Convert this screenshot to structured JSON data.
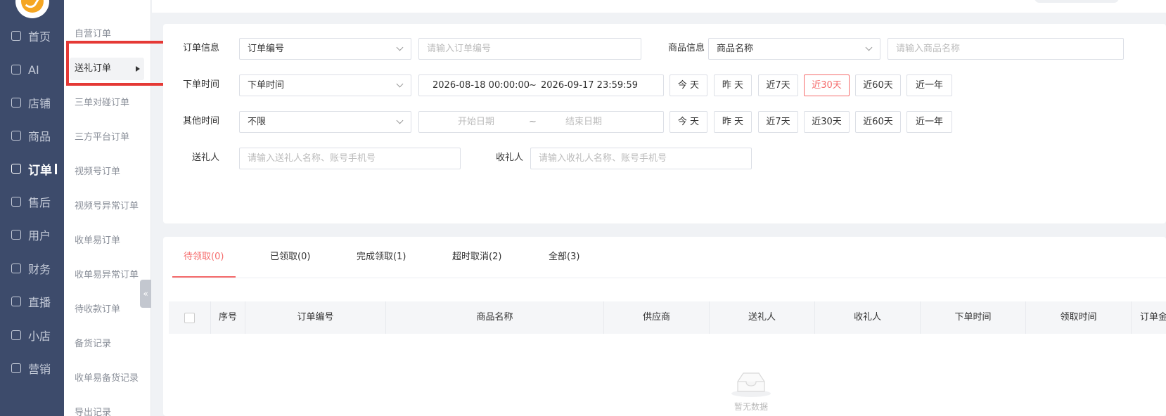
{
  "nav": {
    "items": [
      {
        "label": "首页",
        "icon": "home-icon"
      },
      {
        "label": "AI",
        "icon": "robot-icon"
      },
      {
        "label": "店铺",
        "icon": "shop-icon"
      },
      {
        "label": "商品",
        "icon": "goods-icon"
      },
      {
        "label": "订单",
        "icon": "order-icon",
        "active": true
      },
      {
        "label": "售后",
        "icon": "after-sales-icon"
      },
      {
        "label": "用户",
        "icon": "user-icon"
      },
      {
        "label": "财务",
        "icon": "finance-icon"
      },
      {
        "label": "直播",
        "icon": "live-icon"
      },
      {
        "label": "小店",
        "icon": "store-icon"
      },
      {
        "label": "营销",
        "icon": "marketing-icon"
      }
    ]
  },
  "submenu": {
    "items": [
      {
        "label": "自营订单"
      },
      {
        "label": "送礼订单",
        "active": true
      },
      {
        "label": "三单对碰订单"
      },
      {
        "label": "三方平台订单"
      },
      {
        "label": "视频号订单"
      },
      {
        "label": "视频号异常订单"
      },
      {
        "label": "收单易订单"
      },
      {
        "label": "收单易异常订单"
      },
      {
        "label": "待收款订单"
      },
      {
        "label": "备货记录"
      },
      {
        "label": "收单易备货记录"
      },
      {
        "label": "导出记录"
      }
    ],
    "collapse_glyph": "«"
  },
  "filters": {
    "order_info_label": "订单信息",
    "order_info_select": "订单编号",
    "order_info_placeholder": "请输入订单编号",
    "goods_info_label": "商品信息",
    "goods_info_select": "商品名称",
    "goods_info_placeholder": "请输入商品名称",
    "order_time_label": "下单时间",
    "order_time_select": "下单时间",
    "order_time_start": "2026-08-18 00:00:00",
    "order_time_sep": "~",
    "order_time_end": "2026-09-17 23:59:59",
    "other_time_label": "其他时间",
    "other_time_select": "不限",
    "other_time_start": "开始日期",
    "other_time_sep": "~",
    "other_time_end": "结束日期",
    "quick_buttons": [
      "今 天",
      "昨 天",
      "近7天",
      "近30天",
      "近60天",
      "近一年"
    ],
    "active_quick": "近30天",
    "sender_label": "送礼人",
    "sender_placeholder": "请输入送礼人名称、账号手机号",
    "receiver_label": "收礼人",
    "receiver_placeholder": "请输入收礼人名称、账号手机号"
  },
  "tabs": [
    "待领取(0)",
    "已领取(0)",
    "完成领取(1)",
    "超时取消(2)",
    "全部(3)"
  ],
  "active_tab": "待领取(0)",
  "table": {
    "columns": [
      "序号",
      "订单编号",
      "商品名称",
      "供应商",
      "送礼人",
      "收礼人",
      "下单时间",
      "领取时间",
      "订单金"
    ],
    "rows": [],
    "empty_text": "暂无数据"
  },
  "colors": {
    "nav_bg": "#3d4b6b",
    "accent": "#f56c6c",
    "highlight_box": "#e53935"
  }
}
